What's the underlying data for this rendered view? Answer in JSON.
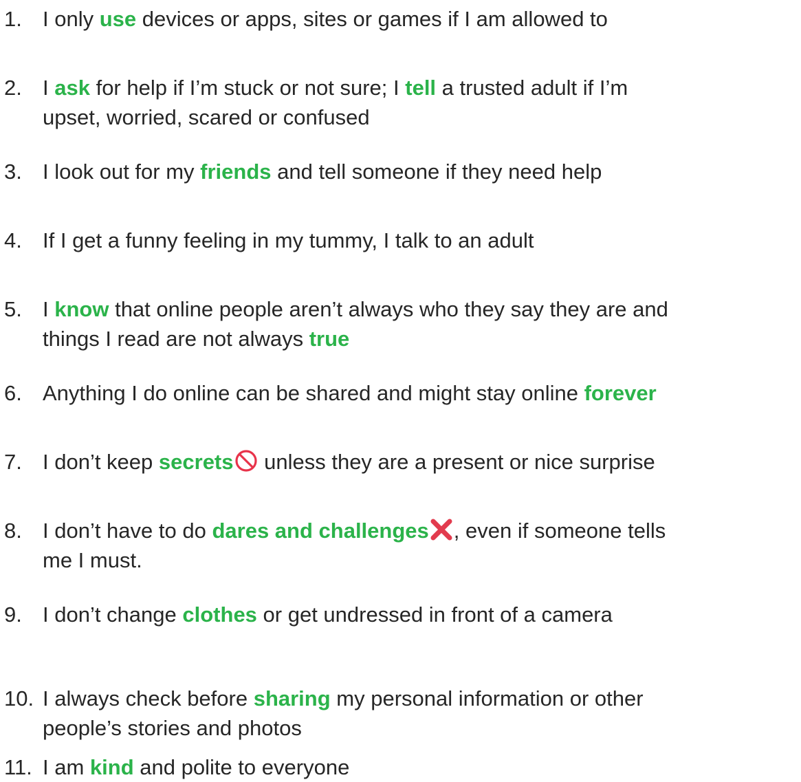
{
  "rules": [
    {
      "number": "1.",
      "lines": [
        [
          {
            "text": "I only "
          },
          {
            "text": "use",
            "highlight": true
          },
          {
            "text": " devices or apps, sites or games if I am allowed to"
          }
        ]
      ]
    },
    {
      "number": "2.",
      "lines": [
        [
          {
            "text": "I "
          },
          {
            "text": "ask",
            "highlight": true
          },
          {
            "text": " for help if I’m stuck or not sure; I "
          },
          {
            "text": "tell",
            "highlight": true
          },
          {
            "text": " a trusted adult if I’m"
          }
        ],
        [
          {
            "text": "upset, worried, scared or confused"
          }
        ]
      ]
    },
    {
      "number": "3.",
      "lines": [
        [
          {
            "text": "I look out for my "
          },
          {
            "text": "friends",
            "highlight": true
          },
          {
            "text": " and tell someone if they need help"
          }
        ]
      ]
    },
    {
      "number": "4.",
      "lines": [
        [
          {
            "text": "If I get a funny feeling in my tummy, I talk to an adult"
          }
        ]
      ]
    },
    {
      "number": "5.",
      "lines": [
        [
          {
            "text": "I "
          },
          {
            "text": "know",
            "highlight": true
          },
          {
            "text": " that online people aren’t always who they say they are and"
          }
        ],
        [
          {
            "text": "things I read are not always "
          },
          {
            "text": "true",
            "highlight": true
          }
        ]
      ]
    },
    {
      "number": "6.",
      "lines": [
        [
          {
            "text": "Anything I do online can be shared and might stay online "
          },
          {
            "text": "forever",
            "highlight": true
          }
        ]
      ]
    },
    {
      "number": "7.",
      "lines": [
        [
          {
            "text": "I don’t keep "
          },
          {
            "text": "secrets",
            "highlight": true
          },
          {
            "icon": "prohibited-icon"
          },
          {
            "text": " unless they are a present or nice surprise"
          }
        ]
      ]
    },
    {
      "number": "8.",
      "lines": [
        [
          {
            "text": "I don’t have to do "
          },
          {
            "text": "dares and challenges",
            "highlight": true
          },
          {
            "icon": "cross-mark-icon"
          },
          {
            "text": ", even if someone tells"
          }
        ],
        [
          {
            "text": "me I must."
          }
        ]
      ]
    },
    {
      "number": "9.",
      "lines": [
        [
          {
            "text": "I don’t change "
          },
          {
            "text": "clothes",
            "highlight": true
          },
          {
            "text": " or get undressed in front of a camera"
          }
        ]
      ]
    },
    {
      "number": "10.",
      "lines": [
        [
          {
            "text": "I always check before "
          },
          {
            "text": "sharing",
            "highlight": true
          },
          {
            "text": " my personal information or other"
          }
        ],
        [
          {
            "text": "people’s stories and photos"
          }
        ]
      ]
    },
    {
      "number": "11.",
      "lines": [
        [
          {
            "text": "I am "
          },
          {
            "text": "kind",
            "highlight": true
          },
          {
            "text": " and polite to everyone"
          }
        ]
      ]
    }
  ],
  "colors": {
    "highlight": "#2bb34a",
    "text": "#262626",
    "prohibited": "#e8334a",
    "cross": "#e23b4e"
  }
}
